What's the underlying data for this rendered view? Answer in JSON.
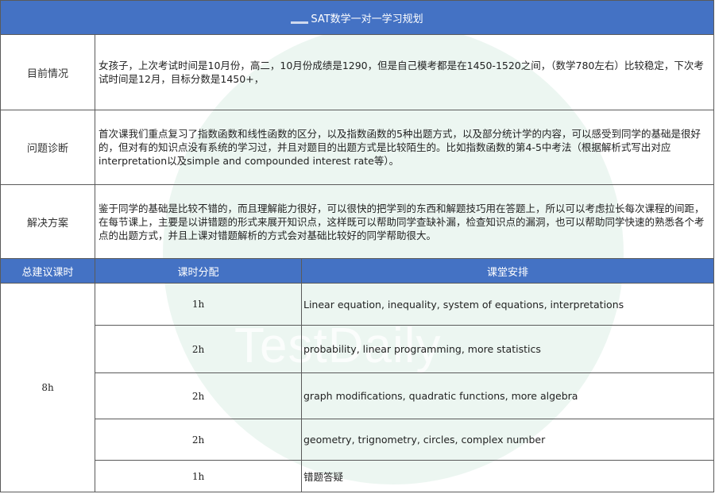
{
  "title": "SAT数学一对一学习规划",
  "watermark": "TestDaily",
  "colors": {
    "header_bg": "#4472c4",
    "watermark_circle": "#dcefe6"
  },
  "current_situation": {
    "label": "目前情况",
    "text": "女孩子，上次考试时间是10月份，高二，10月份成绩是1290，但是自己模考都是在1450-1520之间，（数学780左右）比较稳定，下次考试时间是12月，目标分数是1450+，"
  },
  "diagnosis": {
    "label": "问题诊断",
    "text": "首次课我们重点复习了指数函数和线性函数的区分，以及指数函数的5种出题方式，以及部分统计学的内容，可以感受到同学的基础是很好的，但对有的知识点没有系统的学习过，并且对题目的出题方式是比较陌生的。比如指数函数的第4-5中考法（根据解析式写出对应interpretation以及simple and compounded interest rate等）。"
  },
  "solution": {
    "label": "解决方案",
    "text": "鉴于同学的基础是比较不错的，而且理解能力很好，可以很快的把学到的东西和解题技巧用在答题上，所以可以考虑拉长每次课程的间距，在每节课上，主要是以讲错题的形式来展开知识点，这样既可以帮助同学查缺补漏，检查知识点的漏洞，也可以帮助同学快速的熟悉各个考点的出题方式，并且上课对错题解析的方式会对基础比较好的同学帮助很大。"
  },
  "schedule_header": {
    "total": "总建议课时",
    "allocation": "课时分配",
    "arrangement": "课堂安排"
  },
  "total_hours": "8h",
  "sessions": [
    {
      "hours": "1h",
      "topic": "Linear equation, inequality, system of equations, interpretations"
    },
    {
      "hours": "2h",
      "topic": "probability, linear programming, more statistics"
    },
    {
      "hours": "2h",
      "topic": "graph modifications, quadratic functions, more algebra"
    },
    {
      "hours": "2h",
      "topic": "geometry, trignometry, circles, complex number"
    },
    {
      "hours": "1h",
      "topic": "错题答疑"
    }
  ]
}
